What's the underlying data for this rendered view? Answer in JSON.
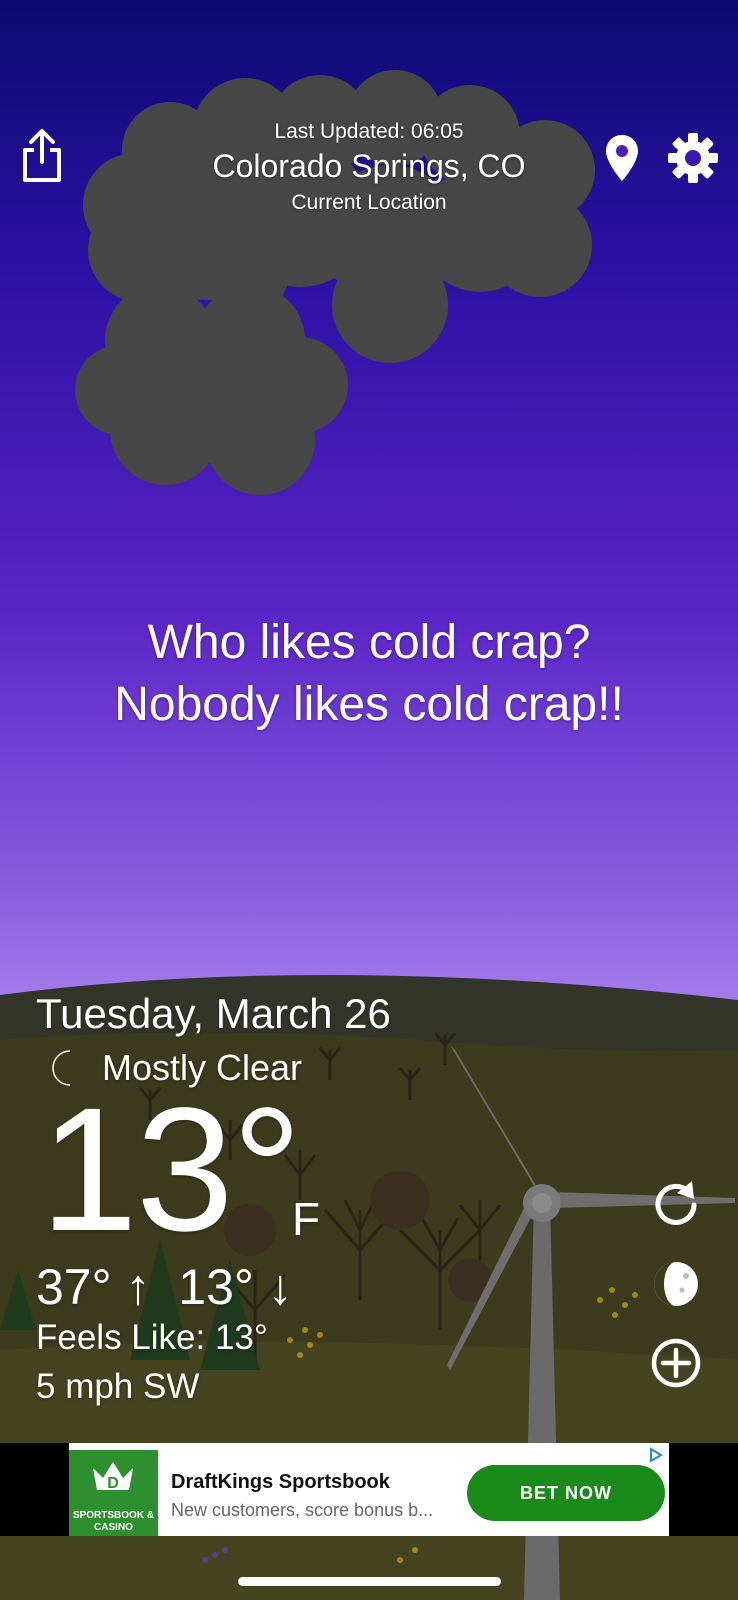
{
  "header": {
    "last_updated": "Last Updated: 06:05",
    "location": "Colorado Springs, CO",
    "location_sub": "Current Location",
    "share_icon": "share-icon",
    "pin_icon": "map-pin-icon",
    "settings_icon": "gear-icon"
  },
  "quote": {
    "line1": "Who likes cold crap?",
    "line2": "Nobody likes cold crap!!"
  },
  "weather": {
    "date": "Tuesday, March 26",
    "condition": "Mostly Clear",
    "condition_icon": "moon-icon",
    "temperature": "13°",
    "unit": "F",
    "high_low": "37° ↑  13° ↓",
    "feels_like": "Feels Like: 13°",
    "wind": "5 mph SW"
  },
  "side_buttons": {
    "refresh_icon": "refresh-icon",
    "moon_phase_icon": "moon-phase-icon",
    "add_icon": "add-icon"
  },
  "ad": {
    "logo_text": "SPORTSBOOK & CASINO",
    "title": "DraftKings Sportsbook",
    "description": "New customers, score bonus b...",
    "cta": "BET NOW"
  },
  "colors": {
    "sky_top": "#0d0a73",
    "sky_bottom": "#c9a8ff",
    "cloud": "#474747",
    "hill": "#33352b",
    "ground": "#3d3b1d",
    "ad_green": "#1a8a1a",
    "moon_blue": "#1c6fd6"
  }
}
